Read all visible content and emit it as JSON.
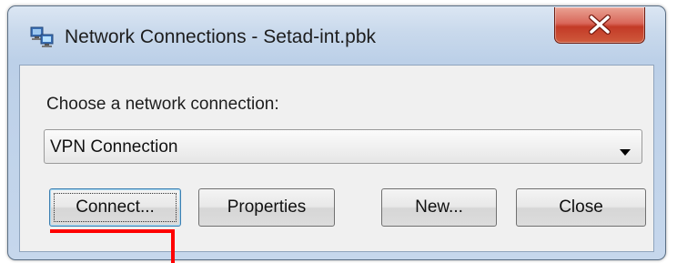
{
  "window": {
    "title": "Network Connections - Setad-int.pbk",
    "icon": "network-connections-icon",
    "close_icon": "close-x-icon"
  },
  "form": {
    "prompt_label": "Choose a network connection:",
    "selected_connection": "VPN Connection",
    "dropdown_icon": "chevron-down-icon"
  },
  "buttons": {
    "connect": "Connect...",
    "properties": "Properties",
    "new": "New...",
    "close": "Close"
  },
  "colors": {
    "annotation": "#ff0000",
    "close_button": "#c33a27",
    "focus_border": "#3c7fb1"
  }
}
